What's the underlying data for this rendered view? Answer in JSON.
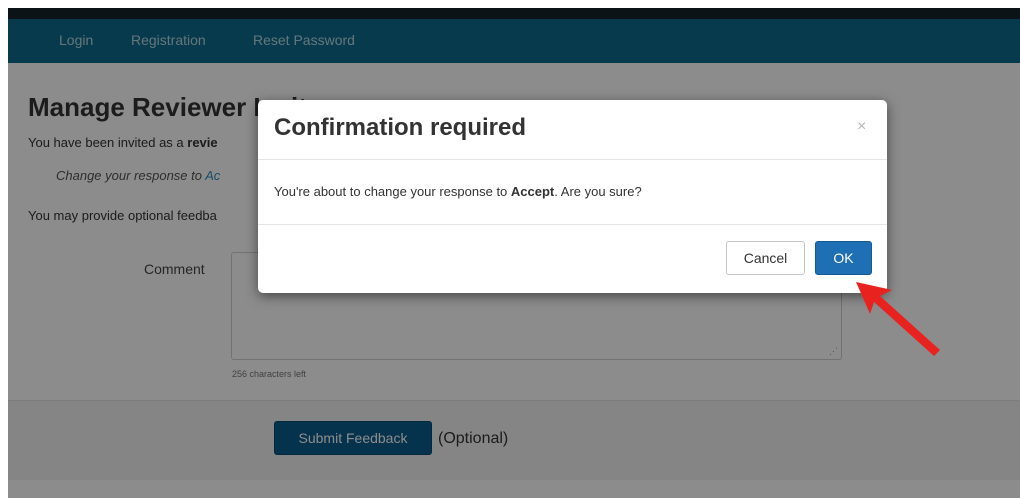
{
  "nav": {
    "items": [
      "Login",
      "Registration",
      "Reset Password"
    ]
  },
  "page": {
    "title": "Manage Reviewer Invite",
    "invited_prefix": "You have been invited as a ",
    "invited_bold": "revie",
    "change_prefix": "Change your response to ",
    "change_link": "Ac",
    "feedback_text": "You may provide optional feedba"
  },
  "form": {
    "comment_label": "Comment",
    "comment_value": "",
    "resize_glyph": "⋰",
    "chars_left": "256 characters left",
    "submit_label": "Submit Feedback",
    "optional_note": "(Optional)"
  },
  "modal": {
    "title": "Confirmation required",
    "close_glyph": "×",
    "body_prefix": "You're about to change your response to ",
    "body_bold": "Accept",
    "body_suffix": ". Are you sure?",
    "cancel_label": "Cancel",
    "ok_label": "OK"
  },
  "colors": {
    "navbar": "#0c6b8b",
    "primary_button": "#1f6fb4",
    "submit_button": "#0a5c8a",
    "annotation_arrow": "#e8231f"
  },
  "icons": {
    "close": "close-icon",
    "annotation": "arrow-pointer-icon"
  }
}
